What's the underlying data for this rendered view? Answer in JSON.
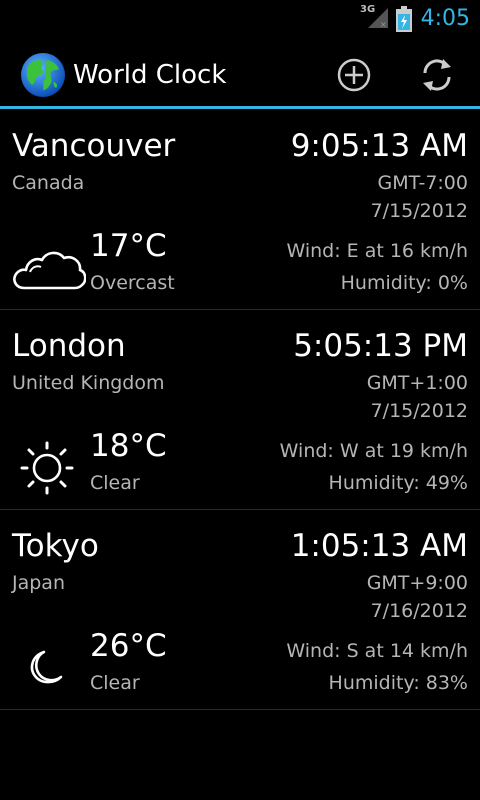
{
  "status_bar": {
    "network": "3G",
    "time": "4:05"
  },
  "action_bar": {
    "title": "World Clock"
  },
  "colors": {
    "accent": "#33b5e5",
    "background": "#000000",
    "primary_text": "#ffffff",
    "secondary_text": "#b5b5b5"
  },
  "icons": {
    "app": "globe-icon",
    "add": "add-circle-icon",
    "refresh": "refresh-icon"
  },
  "cities": [
    {
      "name": "Vancouver",
      "country": "Canada",
      "time": "9:05:13 AM",
      "gmt": "GMT-7:00",
      "date": "7/15/2012",
      "temp": "17°C",
      "condition": "Overcast",
      "wind": "Wind: E at 16 km/h",
      "humidity": "Humidity: 0%",
      "icon": "cloud-icon"
    },
    {
      "name": "London",
      "country": "United Kingdom",
      "time": "5:05:13 PM",
      "gmt": "GMT+1:00",
      "date": "7/15/2012",
      "temp": "18°C",
      "condition": "Clear",
      "wind": "Wind: W at 19 km/h",
      "humidity": "Humidity: 49%",
      "icon": "sun-icon"
    },
    {
      "name": "Tokyo",
      "country": "Japan",
      "time": "1:05:13 AM",
      "gmt": "GMT+9:00",
      "date": "7/16/2012",
      "temp": "26°C",
      "condition": "Clear",
      "wind": "Wind: S at 14 km/h",
      "humidity": "Humidity: 83%",
      "icon": "moon-icon"
    }
  ]
}
